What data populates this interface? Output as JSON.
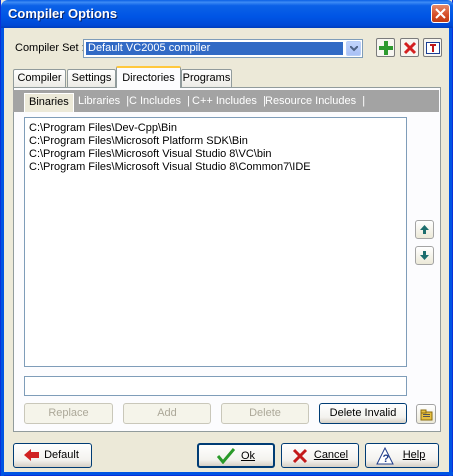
{
  "window": {
    "title": "Compiler Options"
  },
  "compiler_set": {
    "label": "Compiler Set :",
    "value": "Default VC2005 compiler"
  },
  "tabs": [
    {
      "label": "Compiler"
    },
    {
      "label": "Settings"
    },
    {
      "label": "Directories"
    },
    {
      "label": "Programs"
    }
  ],
  "subtabs": [
    {
      "label": "Binaries"
    },
    {
      "label": "Libraries"
    },
    {
      "label": "C Includes"
    },
    {
      "label": "C++ Includes"
    },
    {
      "label": "Resource Includes"
    }
  ],
  "directories": [
    "C:\\Program Files\\Dev-Cpp\\Bin",
    "C:\\Program Files\\Microsoft Platform SDK\\Bin",
    "C:\\Program Files\\Microsoft Visual Studio 8\\VC\\bin",
    "C:\\Program Files\\Microsoft Visual Studio 8\\Common7\\IDE"
  ],
  "edit_field": {
    "value": ""
  },
  "list_buttons": {
    "replace": "Replace",
    "add": "Add",
    "delete": "Delete",
    "delete_invalid": "Delete Invalid"
  },
  "footer": {
    "default": "Default",
    "ok": "Ok",
    "cancel": "Cancel",
    "help": "Help"
  },
  "icons": {
    "add_set": "plus-icon",
    "delete_set": "red-x-icon",
    "rename_set": "rename-icon",
    "move_up": "arrow-up-icon",
    "move_down": "arrow-down-icon",
    "browse": "folder-browse-icon"
  },
  "colors": {
    "title_bar": "#0055e5",
    "selection": "#316ac5",
    "tab_highlight": "#ffc83c",
    "subtab_bar": "#a3a3a3"
  }
}
